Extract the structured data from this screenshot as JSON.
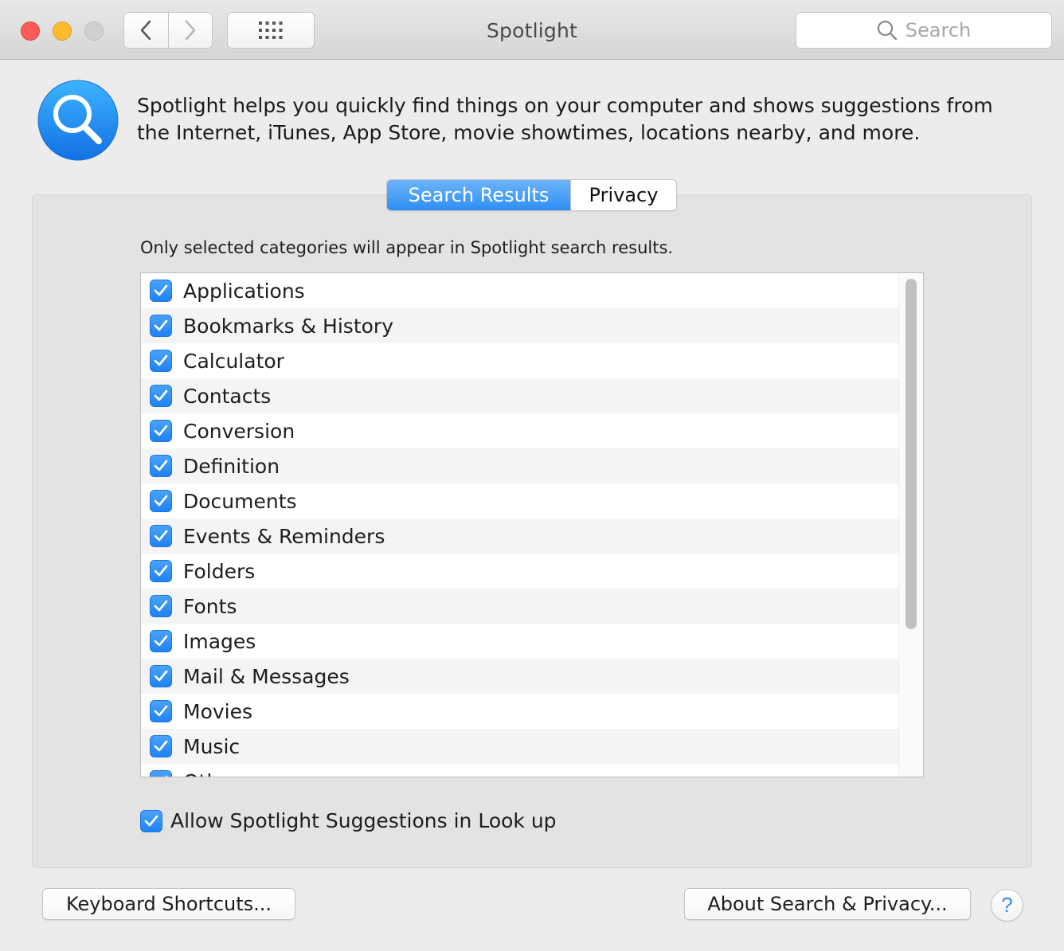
{
  "window": {
    "title": "Spotlight",
    "search_placeholder": "Search"
  },
  "toolbar": {
    "back_icon": "chevron-left-icon",
    "forward_icon": "chevron-right-icon",
    "show_all_icon": "grid-icon"
  },
  "header": {
    "icon": "spotlight-magnifier-icon",
    "description": "Spotlight helps you quickly find things on your computer and shows suggestions from the Internet, iTunes, App Store, movie showtimes, locations nearby, and more."
  },
  "tabs": [
    {
      "label": "Search Results",
      "selected": true
    },
    {
      "label": "Privacy",
      "selected": false
    }
  ],
  "instruction": "Only selected categories will appear in Spotlight search results.",
  "categories": [
    {
      "label": "Applications",
      "checked": true
    },
    {
      "label": "Bookmarks & History",
      "checked": true
    },
    {
      "label": "Calculator",
      "checked": true
    },
    {
      "label": "Contacts",
      "checked": true
    },
    {
      "label": "Conversion",
      "checked": true
    },
    {
      "label": "Definition",
      "checked": true
    },
    {
      "label": "Documents",
      "checked": true
    },
    {
      "label": "Events & Reminders",
      "checked": true
    },
    {
      "label": "Folders",
      "checked": true
    },
    {
      "label": "Fonts",
      "checked": true
    },
    {
      "label": "Images",
      "checked": true
    },
    {
      "label": "Mail & Messages",
      "checked": true
    },
    {
      "label": "Movies",
      "checked": true
    },
    {
      "label": "Music",
      "checked": true
    },
    {
      "label": "Other",
      "checked": true
    }
  ],
  "allow_suggestions": {
    "label": "Allow Spotlight Suggestions in Look up",
    "checked": true
  },
  "buttons": {
    "keyboard_shortcuts": "Keyboard Shortcuts...",
    "about": "About Search & Privacy...",
    "help": "?"
  },
  "colors": {
    "accent": "#2f8ff5",
    "close": "#fc5b57",
    "minimize": "#fdbc2e",
    "zoom_disabled": "#d0d0d0"
  }
}
